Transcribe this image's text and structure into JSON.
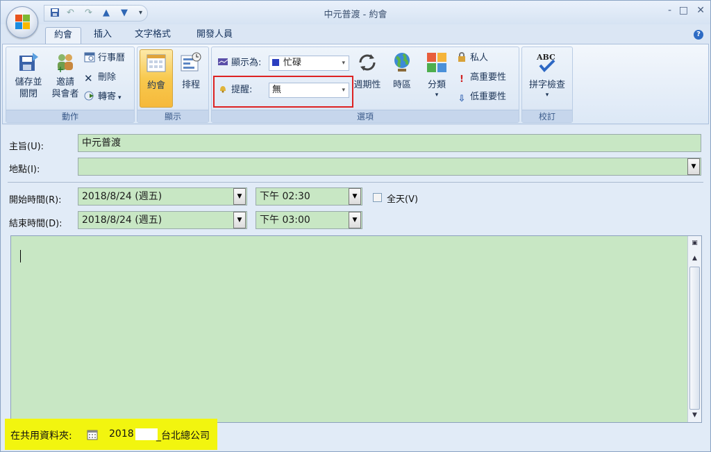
{
  "window": {
    "title": "中元普渡 - 約會",
    "controls": [
      "-",
      "□",
      "✕"
    ]
  },
  "quick_access": [
    "save-icon",
    "undo-icon",
    "redo-icon",
    "prev-icon",
    "next-icon",
    "customize-icon"
  ],
  "tabs": [
    {
      "label": "約會",
      "active": true
    },
    {
      "label": "插入",
      "active": false
    },
    {
      "label": "文字格式",
      "active": false
    },
    {
      "label": "開發人員",
      "active": false
    }
  ],
  "ribbon": {
    "actions": {
      "label": "動作",
      "save_close": [
        "儲存並",
        "關閉"
      ],
      "invite": [
        "邀請",
        "與會者"
      ],
      "calendar": "行事曆",
      "delete": "刪除",
      "forward": "轉寄"
    },
    "show": {
      "label": "顯示",
      "appointment": "約會",
      "schedule": "排程"
    },
    "options": {
      "label": "選項",
      "show_as_label": "顯示為:",
      "show_as_value": "忙碌",
      "reminder_label": "提醒:",
      "reminder_value": "無",
      "recurrence": "週期性",
      "timezone": "時區",
      "categorize": "分類",
      "private": "私人",
      "high_importance": "高重要性",
      "low_importance": "低重要性"
    },
    "proofing": {
      "label": "校訂",
      "spelling": "拼字檢查",
      "abc": "ABC"
    }
  },
  "form": {
    "subject_label": "主旨(U):",
    "subject_value": "中元普渡",
    "location_label": "地點(I):",
    "location_value": "",
    "start_label": "開始時間(R):",
    "start_date": "2018/8/24 (週五)",
    "start_time": "下午 02:30",
    "end_label": "結束時間(D):",
    "end_date": "2018/8/24 (週五)",
    "end_time": "下午 03:00",
    "all_day_label": "全天(V)",
    "all_day_checked": false
  },
  "footer": {
    "label": "在共用資料夾:",
    "year": "2018",
    "suffix": "_台北總公司"
  },
  "colors": {
    "field_bg": "#c8e7c4",
    "footer_highlight": "#f2f50f",
    "reminder_outline": "#dd2222"
  }
}
